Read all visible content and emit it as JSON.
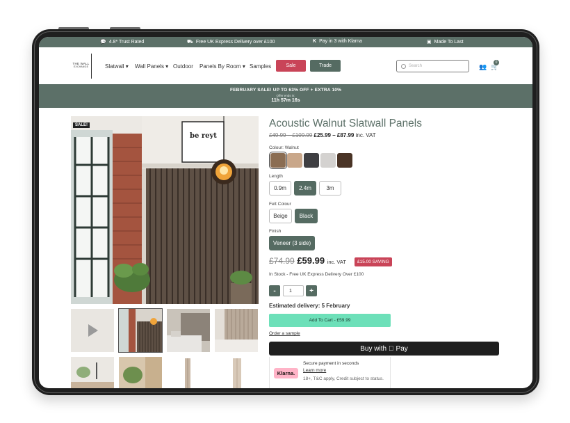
{
  "topbar": {
    "trust": "4.8* Trust Rated",
    "delivery": "Free UK Express Delivery over £100",
    "klarna": "Pay in 3 with Klarna",
    "made": "Made To Last"
  },
  "header": {
    "logo_line1": "THE WALL",
    "logo_line2": "EXCHANGE",
    "nav": [
      "Slatwall",
      "Wall Panels",
      "Outdoor",
      "Panels By Room",
      "Samples"
    ],
    "sale_label": "Sale",
    "trade_label": "Trade",
    "search_placeholder": "Search",
    "cart_count": "0"
  },
  "promo": {
    "headline": "FEBRUARY SALE! UP TO 63% OFF + EXTRA 10%",
    "sub": "Offer ends in:",
    "timer": "11h 57m 16s"
  },
  "gallery": {
    "sale_tag": "SALE!",
    "poster_text": "be reyt"
  },
  "product": {
    "title": "Acoustic Walnut Slatwall Panels",
    "price_range_old": "£49.99 – £109.99",
    "price_range_new": "£25.99 – £87.99",
    "inc_vat": "inc. VAT",
    "colour_label": "Colour: Walnut",
    "swatches": [
      "#8b6d52",
      "#c9a78a",
      "#3f3f42",
      "#d4d2d0",
      "#4a3426"
    ],
    "length_label": "Length",
    "lengths": [
      "0.9m",
      "2.4m",
      "3m"
    ],
    "felt_label": "Felt Colour",
    "felts": [
      "Beige",
      "Black"
    ],
    "finish_label": "Finish",
    "finish": "Veneer (3 side)",
    "old_price": "£74.99",
    "new_price": "£59.99",
    "saving": "£15.00 SAVING",
    "stock": "In Stock - Free UK Express Delivery Over £100",
    "qty_minus": "-",
    "qty_value": "1",
    "qty_plus": "+",
    "estimated": "Estimated delivery: 5 February",
    "add_to_cart": "Add To Cart - £59.99",
    "order_sample": "Order a sample",
    "buy_with": "Buy with",
    "pay": "Pay",
    "klarna_logo": "Klarna.",
    "klarna_t1": "Secure payment in seconds",
    "klarna_t2": "Learn more",
    "klarna_t3": "18+, T&C apply, Credit subject to status."
  },
  "colors": {
    "brand_green": "#5c7068",
    "sale_red": "#c94458",
    "cart_mint": "#6de0b9"
  }
}
